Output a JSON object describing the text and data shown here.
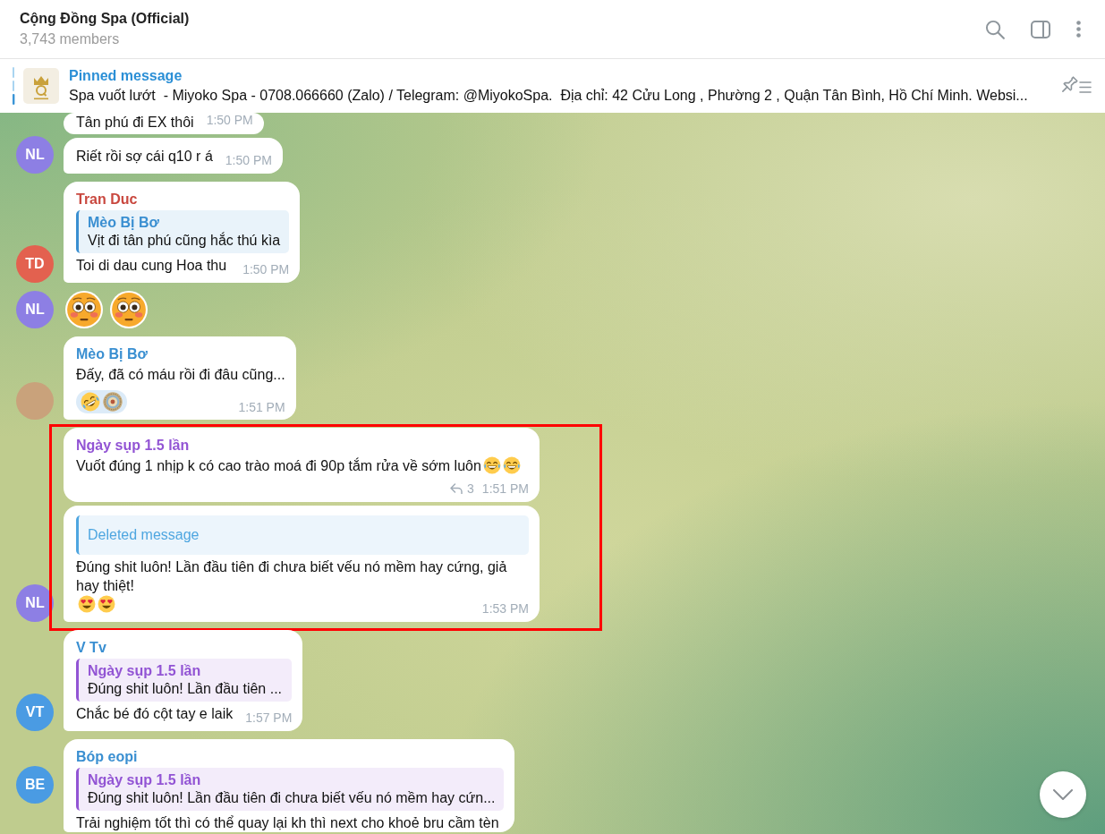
{
  "header": {
    "title": "Cộng Đồng Spa (Official)",
    "subtitle": "3,743 members"
  },
  "pinned": {
    "label": "Pinned message",
    "text": "Spa vuốt lướt  - Miyoko Spa - 0708.066660 (Zalo) / Telegram: @MiyokoSpa.  Địa chỉ: 42 Cửu Long , Phường 2 , Quận Tân Bình, Hồ Chí Minh. Websi..."
  },
  "groups": [
    {
      "avatar": {
        "kind": "initials",
        "initials": "NL",
        "color": "#8d7fe4"
      },
      "highlighted": false,
      "bubbles": [
        {
          "kind": "text",
          "text": "Tân phú đi EX thôi",
          "time": "1:50 PM"
        },
        {
          "kind": "text",
          "text": "Riết rồi sợ cái q10 r á",
          "time": "1:50 PM"
        }
      ]
    },
    {
      "avatar": {
        "kind": "initials",
        "initials": "TD",
        "color": "#e3614f"
      },
      "highlighted": false,
      "bubbles": [
        {
          "kind": "text",
          "sender": {
            "name": "Tran Duc",
            "color": "#c9483f"
          },
          "reply": {
            "kind": "quote",
            "author": "Mèo Bị Bơ",
            "color": "#3a8fd1",
            "text": "Vịt đi tân phú cũng hắc thú kìa"
          },
          "text": "Toi di dau cung Hoa thu",
          "time": "1:50 PM"
        }
      ]
    },
    {
      "avatar": {
        "kind": "initials",
        "initials": "NL",
        "color": "#8d7fe4"
      },
      "highlighted": false,
      "bubbles": [
        {
          "kind": "stickers",
          "stickers": [
            {
              "kind": "flushed"
            },
            {
              "kind": "flushed"
            }
          ]
        }
      ]
    },
    {
      "avatar": {
        "kind": "photo"
      },
      "highlighted": false,
      "bubbles": [
        {
          "kind": "text",
          "sender": {
            "name": "Mèo Bị Bơ",
            "color": "#3a8fd1"
          },
          "text": "Đấy, đã có máu rồi đi đâu cũng...",
          "reactions": [
            {
              "kind": "rolling-laughing"
            },
            {
              "kind": "medallion"
            }
          ],
          "time": "1:51 PM"
        }
      ]
    },
    {
      "avatar": {
        "kind": "initials",
        "initials": "NL",
        "color": "#8d7fe4"
      },
      "highlighted": true,
      "bubbles": [
        {
          "kind": "text",
          "sender": {
            "name": "Ngày sụp 1.5 lần",
            "color": "#9254d4"
          },
          "text": "Vuốt đúng 1 nhịp k có cao trào moá đi 90p tắm rửa về sớm luôn",
          "emoji": [
            {
              "kind": "tears-of-joy"
            },
            {
              "kind": "tears-of-joy"
            }
          ],
          "reply_count": "3",
          "time": "1:51 PM"
        },
        {
          "kind": "text",
          "reply": {
            "kind": "deleted",
            "color": "#4ea6e0",
            "text": "Deleted message"
          },
          "text": "Đúng shit luôn! Lần đầu tiên đi chưa biết vếu nó mềm hay cứng, giả hay thiệt!",
          "emoji": [
            {
              "kind": "heart-eyes"
            },
            {
              "kind": "heart-eyes"
            }
          ],
          "time": "1:53 PM"
        }
      ]
    },
    {
      "avatar": {
        "kind": "initials",
        "initials": "VT",
        "color": "#4a9be3"
      },
      "highlighted": false,
      "bubbles": [
        {
          "kind": "text",
          "sender": {
            "name": "V Tv",
            "color": "#3a8fd1"
          },
          "reply": {
            "kind": "quote",
            "author": "Ngày sụp 1.5 lần",
            "color": "#9254d4",
            "text": "Đúng shit luôn! Lần đầu tiên ..."
          },
          "text": "Chắc bé đó cột tay e laik",
          "time": "1:57 PM"
        }
      ]
    },
    {
      "avatar": {
        "kind": "initials",
        "initials": "BE",
        "color": "#4a9be3"
      },
      "highlighted": false,
      "bubbles": [
        {
          "kind": "text",
          "sender": {
            "name": "Bóp eopi",
            "color": "#3a8fd1"
          },
          "reply": {
            "kind": "quote",
            "author": "Ngày sụp 1.5 lần",
            "color": "#9254d4",
            "text": "Đúng shit luôn! Lần đầu tiên đi chưa biết vếu nó mềm hay cứn..."
          },
          "text": "Trải nghiệm tốt thì có thể quay lại kh thì next cho khoẻ bru cầm tèn"
        }
      ]
    }
  ]
}
